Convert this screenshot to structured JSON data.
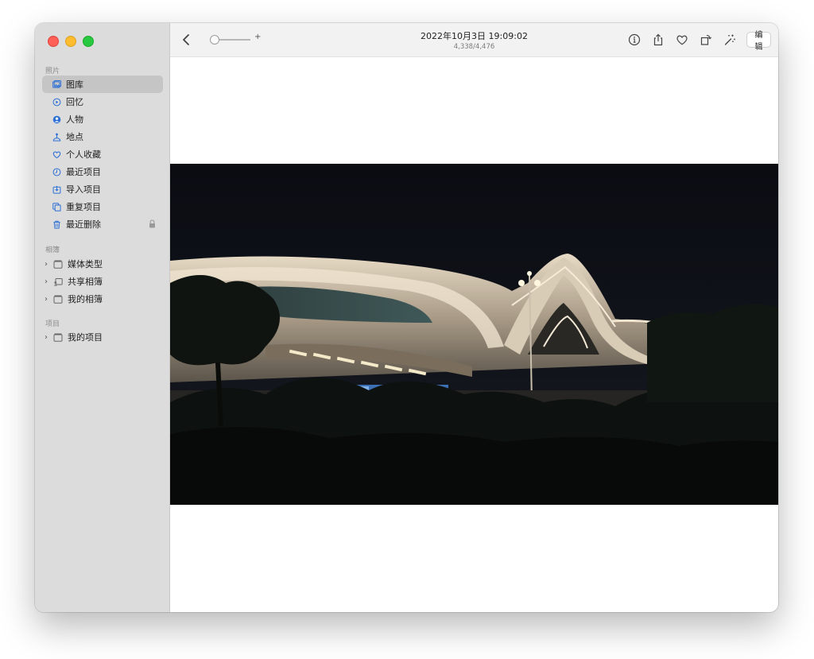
{
  "sidebar": {
    "sections": {
      "photos": "照片",
      "albums": "相簿",
      "projects": "项目"
    },
    "items": [
      {
        "label": "图库",
        "icon": "photo-library-icon",
        "selected": true
      },
      {
        "label": "回忆",
        "icon": "memories-icon"
      },
      {
        "label": "人物",
        "icon": "people-icon"
      },
      {
        "label": "地点",
        "icon": "places-icon"
      },
      {
        "label": "个人收藏",
        "icon": "heart-icon"
      },
      {
        "label": "最近项目",
        "icon": "clock-icon"
      },
      {
        "label": "导入项目",
        "icon": "import-icon"
      },
      {
        "label": "重复项目",
        "icon": "duplicates-icon"
      },
      {
        "label": "最近删除",
        "icon": "trash-icon",
        "locked": true
      }
    ],
    "albums": [
      {
        "label": "媒体类型",
        "icon": "folder-icon"
      },
      {
        "label": "共享相簿",
        "icon": "shared-albums-icon"
      },
      {
        "label": "我的相簿",
        "icon": "folder-icon"
      }
    ],
    "projects": [
      {
        "label": "我的项目",
        "icon": "folder-icon"
      }
    ]
  },
  "toolbar": {
    "title": "2022年10月3日 19:09:02",
    "subtitle": "4,338/4,476",
    "edit_label": "编辑",
    "zoom_plus": "+",
    "icons": [
      "back-chevron-icon",
      "info-icon",
      "share-icon",
      "heart-icon",
      "rotate-icon",
      "magic-wand-icon"
    ]
  },
  "colors": {
    "sidebar_bg": "#dcdcdc",
    "accent": "#2c6fd6",
    "toolbar_bg": "#f2f2f2"
  }
}
